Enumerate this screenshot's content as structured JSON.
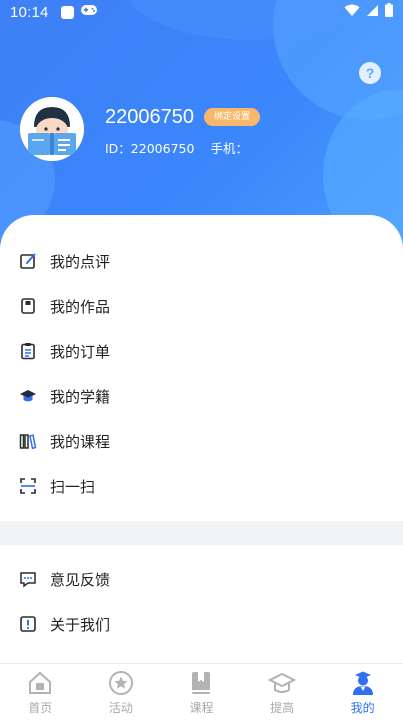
{
  "status_bar": {
    "time": "10:14"
  },
  "profile": {
    "username": "22006750",
    "badge_label": "绑定设置",
    "id_text": "ID：22006750",
    "phone_text": "手机："
  },
  "menu": [
    {
      "label": "我的点评",
      "icon": "edit-icon"
    },
    {
      "label": "我的作品",
      "icon": "works-icon"
    },
    {
      "label": "我的订单",
      "icon": "order-icon"
    },
    {
      "label": "我的学籍",
      "icon": "graduation-cap-icon"
    },
    {
      "label": "我的课程",
      "icon": "books-icon"
    },
    {
      "label": "扫一扫",
      "icon": "scan-icon"
    }
  ],
  "menu2": [
    {
      "label": "意见反馈",
      "icon": "feedback-icon"
    },
    {
      "label": "关于我们",
      "icon": "info-icon"
    }
  ],
  "tabs": [
    {
      "label": "首页",
      "icon": "home-icon",
      "active": false
    },
    {
      "label": "活动",
      "icon": "star-icon",
      "active": false
    },
    {
      "label": "课程",
      "icon": "bookmark-icon",
      "active": false
    },
    {
      "label": "提高",
      "icon": "graduation-icon",
      "active": false
    },
    {
      "label": "我的",
      "icon": "user-icon",
      "active": true
    }
  ],
  "colors": {
    "primary": "#3b83f8",
    "badge": "#f8b86b",
    "tab_active": "#2f6ff0",
    "tab_inactive": "#a9a9a9"
  }
}
